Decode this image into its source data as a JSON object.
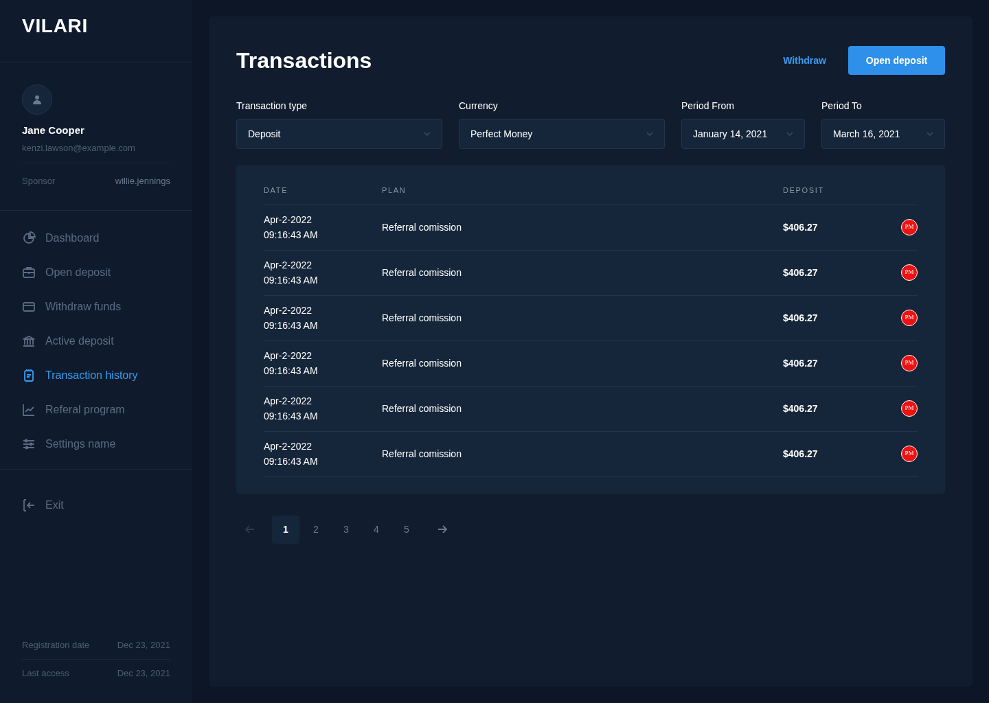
{
  "brand": "VILARI",
  "profile": {
    "name": "Jane Cooper",
    "email": "kenzi.lawson@example.com",
    "sponsor_label": "Sponsor",
    "sponsor": "willie.jennings"
  },
  "nav": [
    {
      "label": "Dashboard",
      "kind": "chart",
      "selected": false
    },
    {
      "label": "Open deposit",
      "kind": "case",
      "selected": false
    },
    {
      "label": "Withdraw funds",
      "kind": "card",
      "selected": false
    },
    {
      "label": "Active deposit",
      "kind": "bank",
      "selected": false
    },
    {
      "label": "Transaction history",
      "kind": "notepad",
      "selected": true
    },
    {
      "label": "Referal program",
      "kind": "trend",
      "selected": false
    },
    {
      "label": "Settings name",
      "kind": "sliders",
      "selected": false
    }
  ],
  "exit": "Exit",
  "meta": [
    {
      "label": "Registration date",
      "value": "Dec 23, 2021"
    },
    {
      "label": "Last access",
      "value": "Dec 23, 2021"
    }
  ],
  "title": "Transactions",
  "actions": {
    "withdraw": "Withdraw",
    "open_deposit": "Open deposit"
  },
  "filters": [
    {
      "label": "Transaction type",
      "value": "Deposit"
    },
    {
      "label": "Currency",
      "value": "Perfect Money"
    },
    {
      "label": "Period From",
      "value": "January 14, 2021"
    },
    {
      "label": "Period To",
      "value": "March 16, 2021"
    }
  ],
  "table": {
    "columns": [
      "DATE",
      "PLAN",
      "DEPOSIT"
    ],
    "rows": [
      {
        "date": "Apr-2-2022",
        "time": "09:16:43 AM",
        "plan": "Referral comission",
        "deposit": "$406.27",
        "badge": "PM"
      },
      {
        "date": "Apr-2-2022",
        "time": "09:16:43 AM",
        "plan": "Referral comission",
        "deposit": "$406.27",
        "badge": "PM"
      },
      {
        "date": "Apr-2-2022",
        "time": "09:16:43 AM",
        "plan": "Referral comission",
        "deposit": "$406.27",
        "badge": "PM"
      },
      {
        "date": "Apr-2-2022",
        "time": "09:16:43 AM",
        "plan": "Referral comission",
        "deposit": "$406.27",
        "badge": "PM"
      },
      {
        "date": "Apr-2-2022",
        "time": "09:16:43 AM",
        "plan": "Referral comission",
        "deposit": "$406.27",
        "badge": "PM"
      },
      {
        "date": "Apr-2-2022",
        "time": "09:16:43 AM",
        "plan": "Referral comission",
        "deposit": "$406.27",
        "badge": "PM"
      }
    ]
  },
  "pagination": {
    "pages": [
      {
        "label": "1",
        "selected": true
      },
      {
        "label": "2",
        "selected": false
      },
      {
        "label": "3",
        "selected": false
      },
      {
        "label": "4",
        "selected": false
      },
      {
        "label": "5",
        "selected": false
      }
    ]
  }
}
